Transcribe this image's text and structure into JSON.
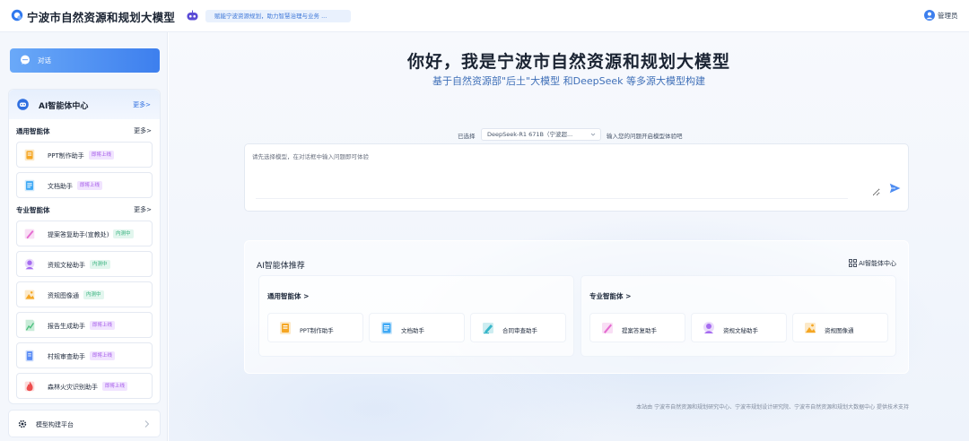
{
  "header": {
    "title": "宁波市自然资源和规划大模型",
    "slogan": "赋能宁波资源规划，助力智慧治理与业务 ...",
    "user": "管理员"
  },
  "sidebar": {
    "chat_label": "对话",
    "agent_center_title": "AI智能体中心",
    "agent_center_more": "更多>",
    "general": {
      "label": "通用智能体",
      "more": "更多>",
      "items": [
        {
          "name": "PPT制作助手",
          "badge": "即将上线",
          "badge_type": "soon",
          "icon": "ppt-icon",
          "color": "#f5a623"
        },
        {
          "name": "文档助手",
          "badge": "即将上线",
          "badge_type": "soon",
          "icon": "document-icon",
          "color": "#3fa9f5"
        }
      ]
    },
    "professional": {
      "label": "专业智能体",
      "more": "更多>",
      "items": [
        {
          "name": "提案答复助手(宣教处)",
          "badge": "内测中",
          "badge_type": "test",
          "icon": "pen-icon",
          "color": "#e56bd0"
        },
        {
          "name": "资规文秘助手",
          "badge": "内测中",
          "badge_type": "test",
          "icon": "assistant-icon",
          "color": "#a66cf0"
        },
        {
          "name": "资规图像通",
          "badge": "内测中",
          "badge_type": "test",
          "icon": "image-icon",
          "color": "#f5a623"
        },
        {
          "name": "报告生成助手",
          "badge": "即将上线",
          "badge_type": "soon",
          "icon": "report-icon",
          "color": "#4cc07d"
        },
        {
          "name": "村规审查助手",
          "badge": "即将上线",
          "badge_type": "soon",
          "icon": "review-icon",
          "color": "#5b8df5"
        },
        {
          "name": "森林火灾识别助手",
          "badge": "即将上线",
          "badge_type": "soon",
          "icon": "fire-icon",
          "color": "#ee4d4d"
        }
      ]
    },
    "platform_label": "模型构建平台"
  },
  "main": {
    "hero_title": "你好，我是宁波市自然资源和规划大模型",
    "hero_subtitle": "基于自然资源部\"后土\"大模型 和DeepSeek 等多源大模型构建",
    "model_prefix": "已选择",
    "model_selected": "DeepSeek-R1 671B（宁波超...",
    "model_suffix": "输入您的问题开启模型体验吧",
    "input_placeholder": "请先选择模型，在对话框中输入问题即可体验",
    "rec_title": "AI智能体推荐",
    "rec_link": "AI智能体中心",
    "groups": [
      {
        "name": "通用智能体 >",
        "items": [
          {
            "name": "PPT制作助手",
            "icon": "ppt-icon",
            "color": "#f5a623"
          },
          {
            "name": "文档助手",
            "icon": "document-icon",
            "color": "#3fa9f5"
          },
          {
            "name": "合同审查助手",
            "icon": "contract-icon",
            "color": "#37b6c9"
          }
        ]
      },
      {
        "name": "专业智能体 >",
        "items": [
          {
            "name": "提案答复助手",
            "icon": "pen-icon",
            "color": "#e56bd0"
          },
          {
            "name": "资规文秘助手",
            "icon": "assistant-icon",
            "color": "#a66cf0"
          },
          {
            "name": "资规图像通",
            "icon": "image-icon",
            "color": "#f5a623"
          }
        ]
      }
    ],
    "footer": "本站由 宁波市自然资源和规划研究中心、宁波市规划设计研究院、宁波市自然资源和规划大数据中心 提供技术支持"
  },
  "colors": {
    "accent": "#3d7fee",
    "soon_badge": "#a357e8",
    "test_badge": "#33b07b"
  }
}
